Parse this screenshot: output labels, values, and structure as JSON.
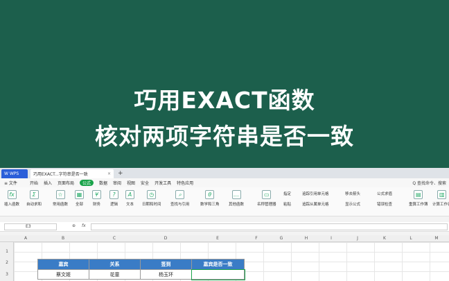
{
  "hero": {
    "line1": "巧用EXACT函数",
    "line2": "核对两项字符串是否一致",
    "bg_color": "#1c5f4c"
  },
  "tabs": {
    "app": "W WPS",
    "doc": "巧用EXACT...字符串是否一致",
    "close": "×",
    "new": "+"
  },
  "menu": {
    "file": "≡ 文件",
    "items": [
      "开始",
      "插入",
      "页面布局",
      "公式",
      "数据",
      "审阅",
      "视图",
      "安全",
      "开发工具",
      "特色应用"
    ],
    "active_index": 3,
    "search": "Q 查找命令、搜索"
  },
  "ribbon": {
    "insert_fn": "插入函数",
    "autosum": "自动求和",
    "common": "常用函数",
    "all": "全部",
    "finance": "财务",
    "logic": "逻辑",
    "text": "文本",
    "datetime": "日期和时间",
    "lookup": "查找与引用",
    "math": "数学和三角",
    "other": "其他函数",
    "name_mgr": "名称管理器",
    "specify": "指定",
    "paste": "粘贴",
    "trace_prec": "追踪引用单元格",
    "trace_dep": "追踪从属单元格",
    "remove_arrows": "移去箭头",
    "show_formula": "显示公式",
    "formula_eval": "公式求值",
    "error_check": "错误检查",
    "recalc": "重算工作簿",
    "calc_sheet": "计算工作表"
  },
  "formula_bar": {
    "name_box": "E3",
    "fx": "fx",
    "value": ""
  },
  "columns": [
    "A",
    "B",
    "C",
    "D",
    "E",
    "F",
    "G",
    "H",
    "I",
    "J",
    "K",
    "L",
    "M"
  ],
  "rows": [
    "1",
    "2",
    "3"
  ],
  "table": {
    "headers": [
      "嘉宾",
      "关系",
      "签到",
      "嘉宾是否一致"
    ],
    "rows": [
      [
        "蔡文姬",
        "花童",
        "杨玉环",
        ""
      ]
    ],
    "header_color": "#3a7cc6"
  }
}
